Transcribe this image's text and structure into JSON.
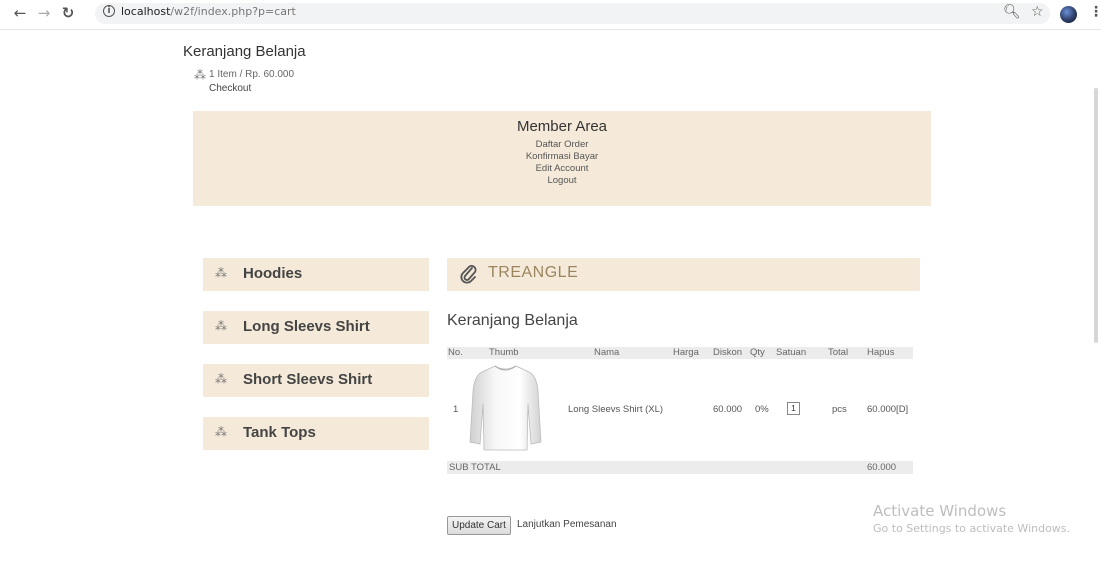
{
  "browser": {
    "url_host": "localhost",
    "url_path": "/w2f/index.php?p=cart",
    "back_icon": "arrow-left-icon",
    "forward_icon": "arrow-right-icon",
    "reload_icon": "reload-icon",
    "info_icon": "info-icon",
    "zoom_icon": "zoom-icon",
    "star_icon": "star-icon",
    "menu_icon": "kebab-menu-icon"
  },
  "top_cart": {
    "title": "Keranjang Belanja",
    "info": "1 Item / Rp. 60.000",
    "checkout": "Checkout"
  },
  "member_area": {
    "title": "Member Area",
    "links": [
      "Daftar Order",
      "Konfirmasi Bayar",
      "Edit Account",
      "Logout"
    ]
  },
  "categories": [
    "Hoodies",
    "Long Sleevs Shirt",
    "Short Sleevs Shirt",
    "Tank Tops"
  ],
  "brand": "TREANGLE",
  "cart": {
    "title": "Keranjang Belanja",
    "headers": [
      "No.",
      "Thumb",
      "Nama",
      "Harga",
      "Diskon",
      "Qty",
      "Satuan",
      "Total",
      "Hapus"
    ],
    "rows": [
      {
        "no": "1",
        "name": "Long Sleevs Shirt (XL)",
        "price": "60.000",
        "discount": "0%",
        "qty": "1",
        "unit": "pcs",
        "total": "60.000[D]"
      }
    ],
    "subtotal_label": "SUB TOTAL",
    "subtotal_value": "60.000",
    "update_button": "Update Cart",
    "continue_link": "Lanjutkan Pemesanan"
  },
  "watermark": {
    "line1": "Activate Windows",
    "line2": "Go to Settings to activate Windows."
  }
}
